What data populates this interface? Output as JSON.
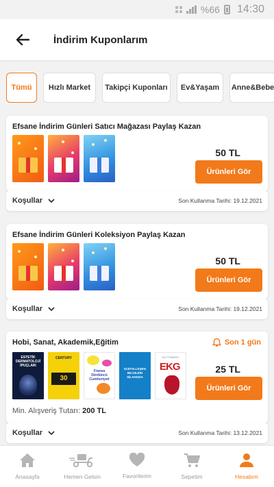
{
  "status_bar": {
    "battery": "%66",
    "time": "14:30"
  },
  "header": {
    "title": "İndirim Kuponlarım"
  },
  "filters": [
    {
      "label": "Tümü",
      "active": true
    },
    {
      "label": "Hızlı Market",
      "active": false
    },
    {
      "label": "Takipçi Kuponları",
      "active": false
    },
    {
      "label": "Ev&Yaşam",
      "active": false
    },
    {
      "label": "Anne&Bebe",
      "active": false
    }
  ],
  "coupons": [
    {
      "title": "Efsane İndirim Günleri Satıcı Mağazası Paylaş Kazan",
      "amount": "50 TL",
      "button": "Ürünleri Gör",
      "conditions_label": "Koşullar",
      "last_use": "Son Kullanma Tarihi: 19.12.2021"
    },
    {
      "title": "Efsane İndirim Günleri Koleksiyon Paylaş Kazan",
      "amount": "50 TL",
      "button": "Ürünleri Gör",
      "conditions_label": "Koşullar",
      "last_use": "Son Kullanma Tarihi: 19.12.2021"
    },
    {
      "title": "Hobi, Sanat, Akademik,Eğitim",
      "expiry_badge": "Son 1 gün",
      "amount": "25 TL",
      "button": "Ürünleri Gör",
      "min_spend_label": "Min. Alışveriş Tutarı:",
      "min_spend_value": "200 TL",
      "conditions_label": "Koşullar",
      "last_use": "Son Kullanma Tarihi: 13.12.2021",
      "book_covers": {
        "book1": "ESTETİK DERMATOLOJİ İPUÇLARI",
        "book2_title": "CENTURY",
        "book2_num": "30",
        "book3": "Fransa Dördüncü Cumhuriyeti",
        "book4": "DIJITALLEŞEN BILGILERI SİLAHSIZA",
        "book5_top": "HUTTOMENT",
        "book5_big": "EKG"
      }
    }
  ],
  "bottom_nav": [
    {
      "label": "Anasayfa",
      "icon": "home-icon",
      "active": false
    },
    {
      "label": "Hemen Gelsin",
      "icon": "scooter-icon",
      "active": false
    },
    {
      "label": "Favorilerim",
      "icon": "heart-icon",
      "active": false
    },
    {
      "label": "Sepetim",
      "icon": "cart-icon",
      "active": false
    },
    {
      "label": "Hesabım",
      "icon": "user-icon",
      "active": true
    }
  ],
  "colors": {
    "accent": "#f27a1a",
    "inactive": "#b5b5b5"
  }
}
